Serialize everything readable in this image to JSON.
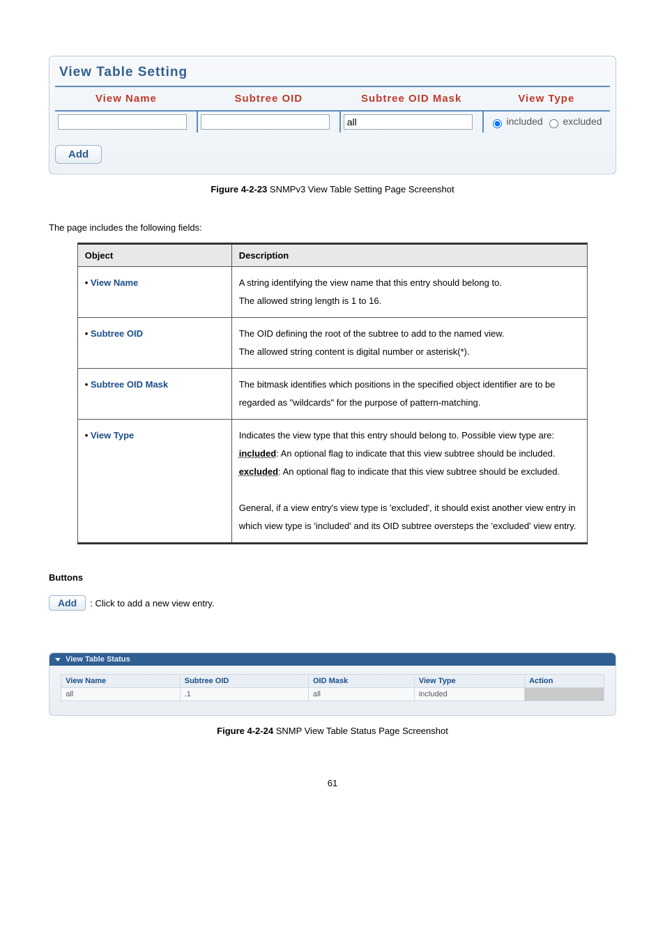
{
  "panel1": {
    "title": "View Table Setting",
    "headers": [
      "View Name",
      "Subtree OID",
      "Subtree OID Mask",
      "View Type"
    ],
    "mask_value": "all",
    "radio_included": "included",
    "radio_excluded": "excluded",
    "add_label": "Add"
  },
  "figure1": {
    "num": "Figure 4-2-23",
    "text": " SNMPv3 View Table Setting Page Screenshot"
  },
  "intro": "The page includes the following fields:",
  "desc": {
    "headers": [
      "Object",
      "Description"
    ],
    "rows": [
      {
        "obj": "View Name",
        "desc": "A string identifying the view name that this entry should belong to.\nThe allowed string length is 1 to 16."
      },
      {
        "obj": "Subtree OID",
        "desc": "The OID defining the root of the subtree to add to the named view.\nThe allowed string content is digital number or asterisk(*)."
      },
      {
        "obj": "Subtree OID Mask",
        "desc": "The bitmask identifies which positions in the specified object identifier are to be regarded as \"wildcards\" for the purpose of pattern-matching."
      }
    ],
    "row4": {
      "obj": "View Type",
      "line1": "Indicates the view type that this entry should belong to. Possible view type are:",
      "inc_term": "included",
      "inc_rest": ": An optional flag to indicate that this view subtree should be included.",
      "exc_term": "excluded",
      "exc_rest": ": An optional flag to indicate that this view subtree should be excluded.",
      "tail": "General, if a view entry's view type is 'excluded', it should exist another view entry in which view type is 'included' and its OID subtree oversteps the 'excluded' view entry."
    }
  },
  "buttons": {
    "heading": "Buttons",
    "add": "Add",
    "add_desc": ": Click to add a new view entry."
  },
  "panel2": {
    "bar": "View Table Status",
    "headers": [
      "View Name",
      "Subtree OID",
      "OID Mask",
      "View Type",
      "Action"
    ],
    "row": {
      "name": "all",
      "oid": ".1",
      "mask": "all",
      "type": "included",
      "action": ""
    }
  },
  "figure2": {
    "num": "Figure 4-2-24",
    "text": " SNMP View Table Status Page Screenshot"
  },
  "page": "61"
}
